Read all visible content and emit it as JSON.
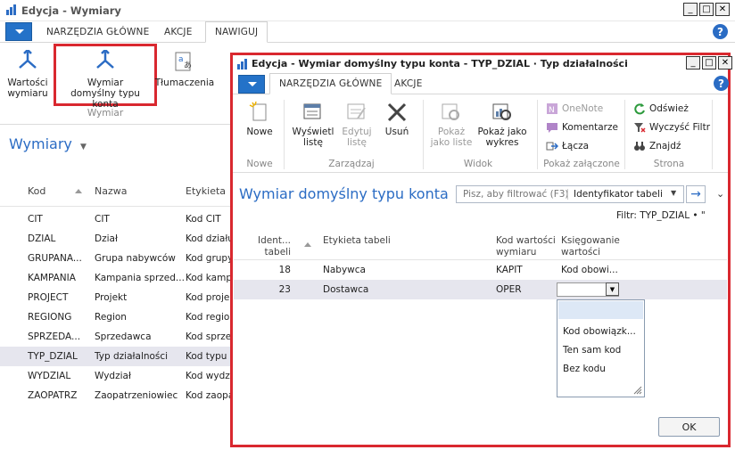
{
  "main_window": {
    "title": "Edycja - Wymiary",
    "tabs": [
      "NARZĘDZIA GŁÓWNE",
      "AKCJE",
      "NAWIGUJ"
    ],
    "ribbon": {
      "btn1": [
        "Wartości",
        "wymiaru"
      ],
      "btn2": [
        "Wymiar",
        "domyślny typu konta"
      ],
      "btn3": "Tłumaczenia",
      "group": "Wymiar"
    },
    "list_title": "Wymiary",
    "columns": [
      "Kod",
      "Nazwa",
      "Etykieta"
    ],
    "rows": [
      [
        "CIT",
        "CIT",
        "Kod CIT"
      ],
      [
        "DZIAL",
        "Dział",
        "Kod działu"
      ],
      [
        "GRUPANA...",
        "Grupa nabywców",
        "Kod grupy"
      ],
      [
        "KAMPANIA",
        "Kampania sprzed...",
        "Kod kampanii"
      ],
      [
        "PROJECT",
        "Projekt",
        "Kod projektu"
      ],
      [
        "REGIONG",
        "Region",
        "Kod regionu"
      ],
      [
        "SPRZEDA...",
        "Sprzedawca",
        "Kod sprzedawcy"
      ],
      [
        "TYP_DZIAL",
        "Typ działalności",
        "Kod typu"
      ],
      [
        "WYDZIAL",
        "Wydział",
        "Kod wydziału"
      ],
      [
        "ZAOPATRZ",
        "Zaopatrzeniowiec",
        "Kod zaopatrz."
      ]
    ],
    "selected_row": 7
  },
  "dialog": {
    "title": "Edycja - Wymiar domyślny typu konta - TYP_DZIAL · Typ działalności",
    "tabs": [
      "NARZĘDZIA GŁÓWNE",
      "AKCJE"
    ],
    "ribbon": {
      "nowe": "Nowe",
      "g_nowe": "Nowe",
      "wyswietl": [
        "Wyświetl",
        "listę"
      ],
      "edytuj": [
        "Edytuj",
        "listę"
      ],
      "usun": "Usuń",
      "g_zarzadzaj": "Zarządzaj",
      "pokaz_liste": [
        "Pokaż",
        "jako liste"
      ],
      "pokaz_wykres": [
        "Pokaż jako",
        "wykres"
      ],
      "g_widok": "Widok",
      "onenote": "OneNote",
      "komentarze": "Komentarze",
      "lacza": "Łącza",
      "g_zalaczone": "Pokaż załączone",
      "odswiez": "Odśwież",
      "wyczysc": "Wyczyść Filtr",
      "znajdz": "Znajdź",
      "g_strona": "Strona"
    },
    "page_title": "Wymiar domyślny typu konta",
    "search_placeholder": "Pisz, aby filtrować (F3)",
    "filter_field": "Identyfikator tabeli",
    "filter_text": "Filtr: TYP_DZIAL • \"",
    "columns": {
      "c1": [
        "Ident...",
        "tabeli"
      ],
      "c2": "Etykieta tabeli",
      "c3": [
        "Kod wartości",
        "wymiaru"
      ],
      "c4": [
        "Księgowanie",
        "wartości"
      ]
    },
    "rows": [
      [
        "18",
        "Nabywca",
        "KAPIT",
        "Kod obowi..."
      ],
      [
        "23",
        "Dostawca",
        "OPER",
        ""
      ]
    ],
    "dropdown_options": [
      "",
      "Kod obowiązk...",
      "Ten sam kod",
      "Bez kodu"
    ],
    "ok": "OK"
  }
}
